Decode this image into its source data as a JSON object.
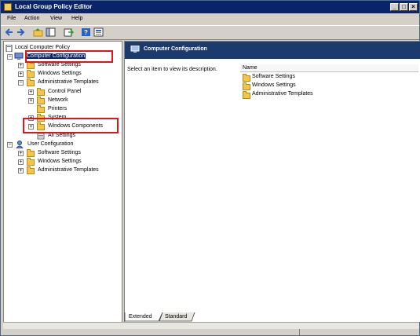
{
  "window": {
    "title": "Local Group Policy Editor"
  },
  "menu": [
    "File",
    "Action",
    "View",
    "Help"
  ],
  "tree": {
    "root": "Local Computer Policy",
    "computer_config": "Computer Configuration",
    "software_settings": "Software Settings",
    "windows_settings": "Windows Settings",
    "admin_templates": "Administrative Templates",
    "control_panel": "Control Panel",
    "network": "Network",
    "printers": "Printers",
    "system": "System",
    "windows_components": "Windows Components",
    "all_settings": "All Settings",
    "user_config": "User Configuration",
    "u_software_settings": "Software Settings",
    "u_windows_settings": "Windows Settings",
    "u_admin_templates": "Administrative Templates"
  },
  "right": {
    "header": "Computer Configuration",
    "description": "Select an item to view its description.",
    "column_name": "Name",
    "items": [
      "Software Settings",
      "Windows Settings",
      "Administrative Templates"
    ]
  },
  "tabs": [
    "Extended",
    "Standard"
  ]
}
